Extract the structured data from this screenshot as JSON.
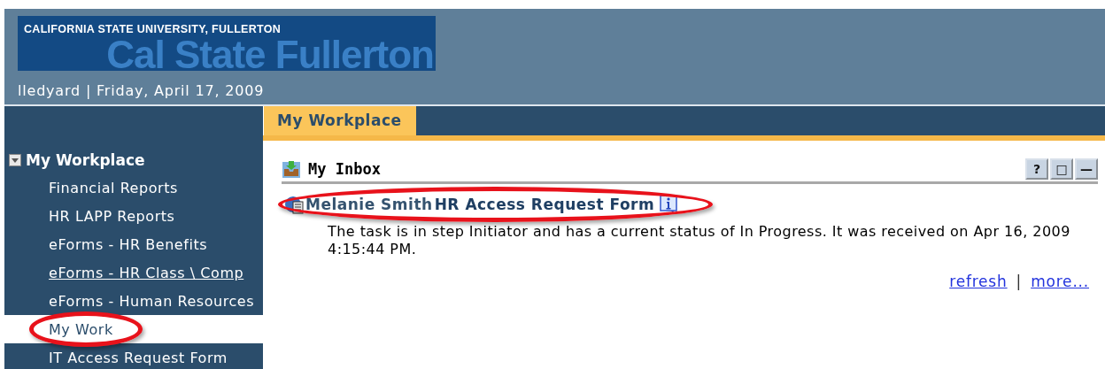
{
  "header": {
    "logo_small": "CALIFORNIA STATE UNIVERSITY, FULLERTON",
    "logo_large": "Cal State Fullerton",
    "user_line": "lledyard | Friday, April 17, 2009"
  },
  "tabs": [
    {
      "label": "My Workplace",
      "selected": true
    }
  ],
  "sidebar": {
    "heading": {
      "label": "My Workplace",
      "expanded": true
    },
    "items": [
      {
        "label": "Financial Reports",
        "selected": false,
        "hovered": false,
        "circled": false
      },
      {
        "label": "HR LAPP Reports",
        "selected": false,
        "hovered": false,
        "circled": false
      },
      {
        "label": "eForms - HR Benefits",
        "selected": false,
        "hovered": false,
        "circled": false
      },
      {
        "label": "eForms - HR Class \\ Comp",
        "selected": false,
        "hovered": true,
        "circled": false
      },
      {
        "label": "eForms - Human Resources",
        "selected": false,
        "hovered": false,
        "circled": false
      },
      {
        "label": "My Work",
        "selected": true,
        "hovered": false,
        "circled": true
      },
      {
        "label": "IT Access Request Form",
        "selected": false,
        "hovered": false,
        "circled": false
      }
    ]
  },
  "inbox": {
    "title": "My Inbox",
    "buttons": [
      "?",
      "□",
      "—"
    ],
    "items": [
      {
        "sender": "Melanie Smith",
        "form": "HR Access Request Form",
        "circled": true,
        "description": "The task is in step Initiator and has a current status of In Progress. It was received on Apr 16, 2009 4:15:44 PM."
      }
    ],
    "links": [
      "refresh",
      "more..."
    ],
    "link_separator": "|"
  }
}
